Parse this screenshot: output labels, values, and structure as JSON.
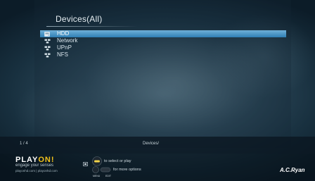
{
  "page": {
    "title": "Devices(All)"
  },
  "devices": [
    {
      "label": "HDD",
      "icon": "hdd-icon",
      "selected": true
    },
    {
      "label": "Network",
      "icon": "network-icon",
      "selected": false
    },
    {
      "label": "UPnP",
      "icon": "network-icon",
      "selected": false
    },
    {
      "label": "NFS",
      "icon": "network-icon",
      "selected": false
    }
  ],
  "status_bar": {
    "pager": "1 / 4",
    "breadcrumb": "Devices/"
  },
  "footer": {
    "brand_part1": "PLAY",
    "brand_part2": "ON!",
    "tagline": "engage your senses",
    "sites": "playonhd.com | playonhd.com",
    "hint_select": "to select or play",
    "hint_options": "for more options",
    "menu_label": "MENU",
    "edit_label": "EDIT",
    "right_logo": "A.C.Ryan"
  },
  "colors": {
    "selection_top": "#6fb0d8",
    "selection_bottom": "#2f7fb4",
    "accent_yellow": "#f2c21b",
    "ok_button": "#f2d44a"
  }
}
